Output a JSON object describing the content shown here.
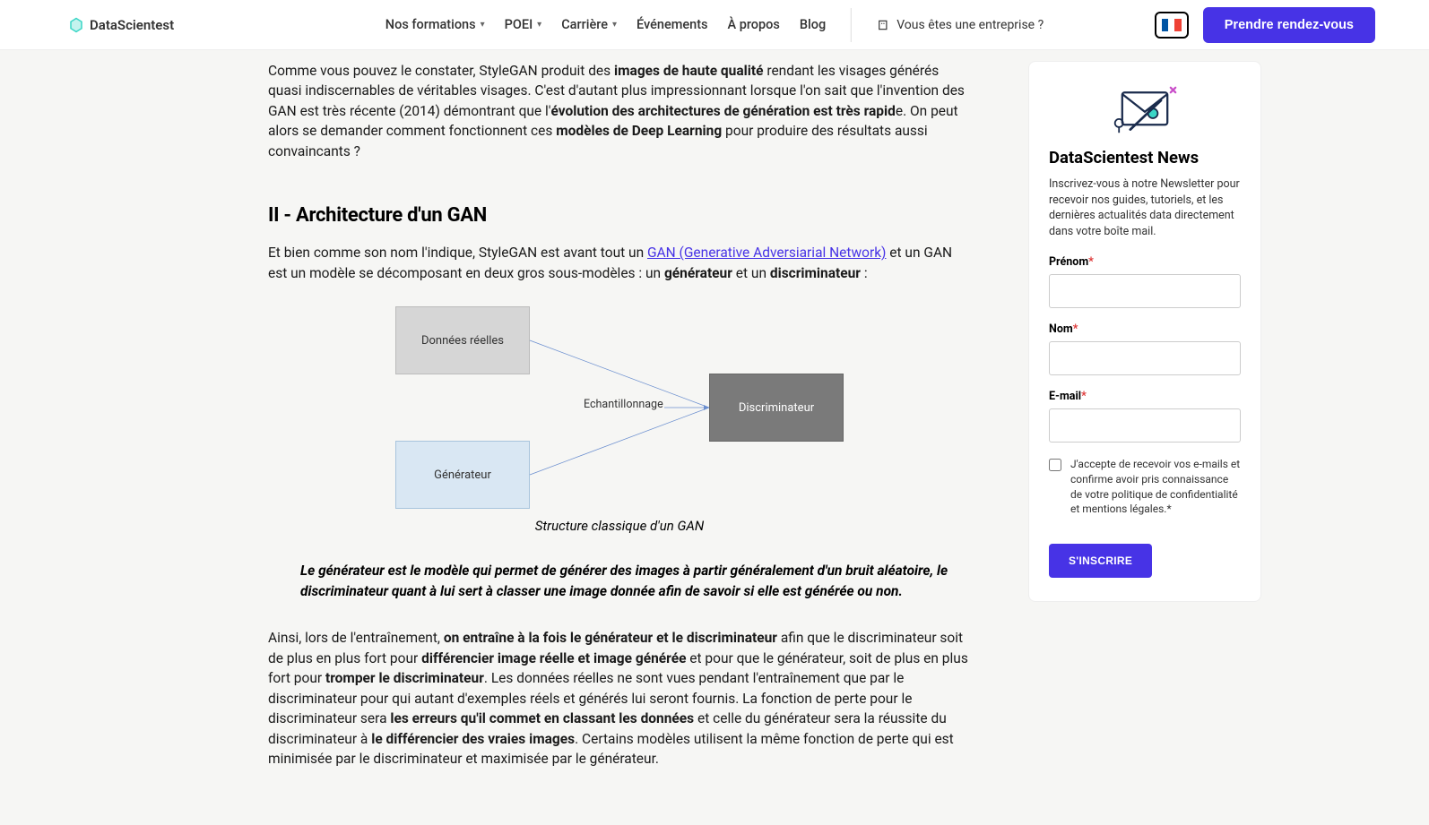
{
  "header": {
    "brand": "DataScientest",
    "nav": [
      {
        "label": "Nos formations",
        "dropdown": true
      },
      {
        "label": "POEI",
        "dropdown": true
      },
      {
        "label": "Carrière",
        "dropdown": true
      },
      {
        "label": "Événements",
        "dropdown": false
      },
      {
        "label": "À propos",
        "dropdown": false
      },
      {
        "label": "Blog",
        "dropdown": false
      }
    ],
    "enterprise": "Vous êtes une entreprise ?",
    "cta": "Prendre rendez-vous"
  },
  "article": {
    "p1_a": "Comme vous pouvez le constater, StyleGAN produit des ",
    "p1_b": "images de haute qualité",
    "p1_c": " rendant les visages générés quasi indiscernables de véritables visages. C'est d'autant plus impressionnant lorsque l'on sait que l'invention des GAN est très récente (2014) démontrant que l'",
    "p1_d": "évolution des architectures de génération est très rapid",
    "p1_e": "e. On peut alors se demander comment fonctionnent ces ",
    "p1_f": "modèles de Deep Learning",
    "p1_g": " pour produire des résultats aussi convaincants ?",
    "h2": "II - Architecture d'un GAN",
    "p2_a": "Et bien comme son nom l'indique, StyleGAN est avant tout un ",
    "p2_link": "GAN (Generative Adversiarial Network)",
    "p2_b": " et un GAN est un modèle se décomposant en deux gros sous-modèles : un ",
    "p2_c": "générateur",
    "p2_d": " et un ",
    "p2_e": "discriminateur",
    "p2_f": " : ",
    "diagram": {
      "real": "Données réelles",
      "generator": "Générateur",
      "sampling": "Echantillonnage",
      "discriminator": "Discriminateur"
    },
    "caption": "Structure classique d'un GAN",
    "quote": "Le générateur est le modèle qui permet de générer des images à partir généralement d'un bruit aléatoire, le discriminateur quant à lui sert à classer une image donnée afin de savoir si elle est générée ou non.",
    "p3_a": "Ainsi, lors de l'entraînement, ",
    "p3_b": "on entraîne à la fois le générateur et le discriminateur",
    "p3_c": " afin que le discriminateur soit de plus en plus fort pour ",
    "p3_d": "différencier image réelle et image générée",
    "p3_e": " et pour que le générateur, soit de plus en plus fort pour ",
    "p3_f": "tromper le discriminateur",
    "p3_g": ". Les données réelles ne sont vues pendant l'entraînement que par le discriminateur pour qui autant d'exemples réels et générés lui seront fournis. La fonction de perte pour le discriminateur sera ",
    "p3_h": "les erreurs qu'il commet en classant les données",
    "p3_i": " et celle du générateur sera la réussite du discriminateur à ",
    "p3_j": "le différencier des vraies images",
    "p3_k": ". Certains modèles utilisent la même fonction de perte qui est minimisée par le discriminateur et maximisée par le générateur."
  },
  "sidebar": {
    "title": "DataScientest News",
    "desc": "Inscrivez-vous à notre Newsletter pour recevoir nos guides, tutoriels, et les dernières actualités data directement dans votre boîte mail.",
    "prenom_label": "Prénom",
    "nom_label": "Nom",
    "email_label": "E-mail",
    "consent": "J'accepte de recevoir vos e-mails et confirme avoir pris connaissance de votre politique de confidentialité et mentions légales.",
    "submit": "S'INSCRIRE"
  }
}
